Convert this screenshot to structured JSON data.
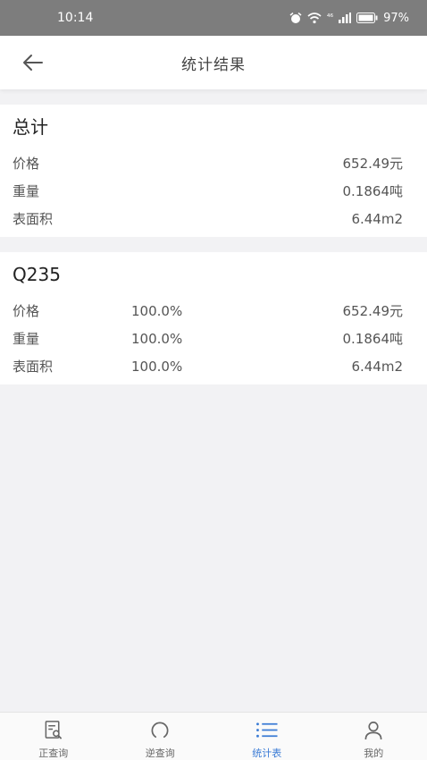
{
  "status_bar": {
    "time": "10:14",
    "network": "⁴⁶",
    "battery": "97%"
  },
  "header": {
    "title": "统计结果"
  },
  "summary": {
    "title": "总计",
    "rows": [
      {
        "label": "价格",
        "value": "652.49元"
      },
      {
        "label": "重量",
        "value": "0.1864吨"
      },
      {
        "label": "表面积",
        "value": "6.44m2"
      }
    ]
  },
  "material": {
    "title": "Q235",
    "rows": [
      {
        "label": "价格",
        "percent": "100.0%",
        "value": "652.49元"
      },
      {
        "label": "重量",
        "percent": "100.0%",
        "value": "0.1864吨"
      },
      {
        "label": "表面积",
        "percent": "100.0%",
        "value": "6.44m2"
      }
    ]
  },
  "tabs": [
    {
      "label": "正查询",
      "icon": "document-search-icon",
      "active": false
    },
    {
      "label": "逆查询",
      "icon": "reverse-circle-icon",
      "active": false
    },
    {
      "label": "统计表",
      "icon": "list-icon",
      "active": true
    },
    {
      "label": "我的",
      "icon": "user-icon",
      "active": false
    }
  ],
  "colors": {
    "accent": "#3a7bd5",
    "status_bar": "#7d7d7d",
    "background": "#f2f2f4"
  }
}
